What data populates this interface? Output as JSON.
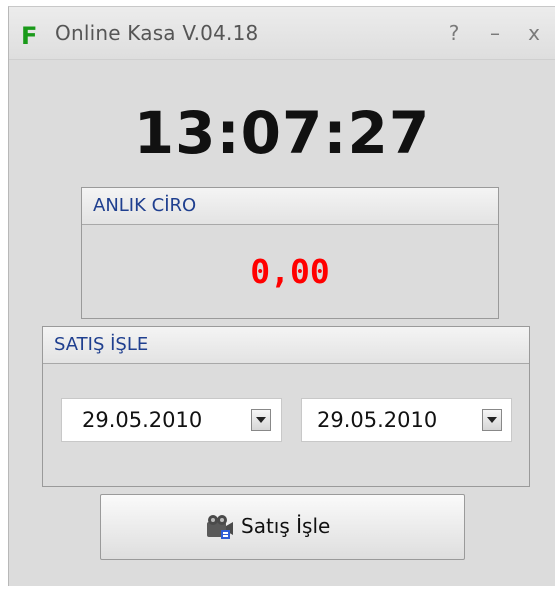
{
  "window": {
    "app_icon": "F",
    "title": "Online Kasa V.04.18",
    "help_glyph": "?",
    "minimize_glyph": "–",
    "close_glyph": "x"
  },
  "clock": "13:07:27",
  "anlik_ciro": {
    "header": "ANLIK CİRO",
    "value": "0,00"
  },
  "satis_isle": {
    "header": "SATIŞ İŞLE",
    "start_date": "29.05.2010",
    "end_date": "29.05.2010"
  },
  "action_button": {
    "label": "Satış İşle",
    "icon": "film-reel-icon"
  },
  "colors": {
    "ciro_value": "#ff0000",
    "group_header_text": "#1f3f8f",
    "app_icon": "#1a9a1a"
  }
}
